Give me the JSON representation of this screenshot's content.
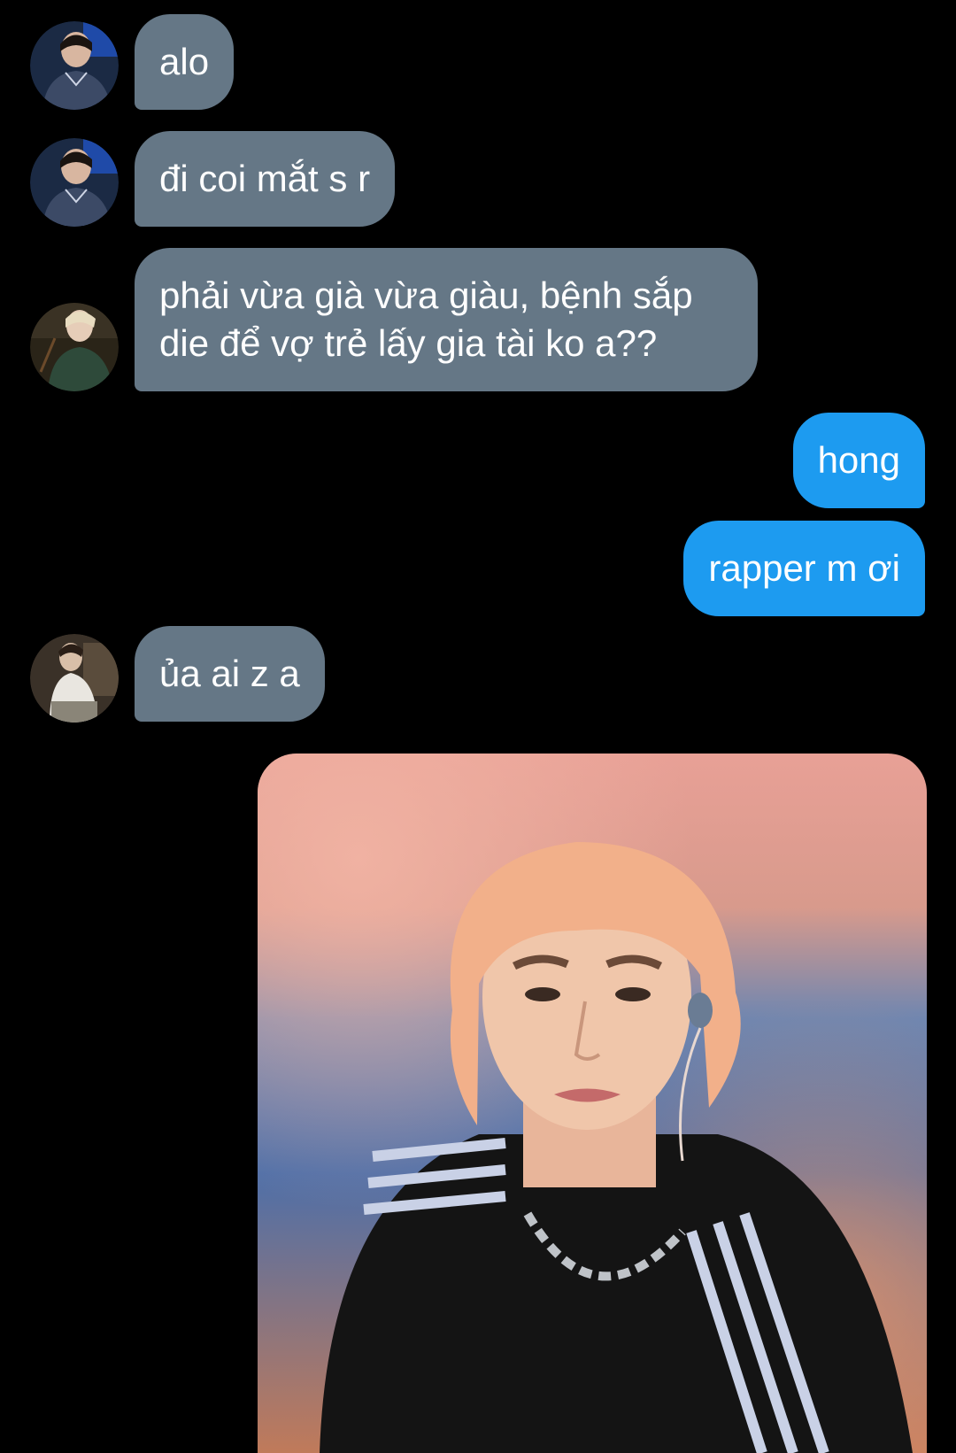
{
  "conversation": {
    "messages": [
      {
        "direction": "incoming",
        "text": "alo",
        "avatar": "avatar-photo-a"
      },
      {
        "direction": "incoming",
        "text": "đi coi mắt s r",
        "avatar": "avatar-photo-a"
      },
      {
        "direction": "incoming",
        "text": "phải vừa già vừa giàu, bệnh sắp die để vợ trẻ lấy gia tài ko a??",
        "avatar": "avatar-photo-b"
      },
      {
        "direction": "outgoing",
        "text": "hong"
      },
      {
        "direction": "outgoing",
        "text": "rapper m ơi"
      },
      {
        "direction": "incoming",
        "text": "ủa ai z a",
        "avatar": "avatar-photo-c"
      }
    ],
    "attachment": {
      "type": "image",
      "description_icon": "photo-attachment"
    }
  },
  "colors": {
    "background": "#000000",
    "incoming_bubble": "#657786",
    "outgoing_bubble": "#1d9bf0",
    "text": "#ffffff"
  }
}
